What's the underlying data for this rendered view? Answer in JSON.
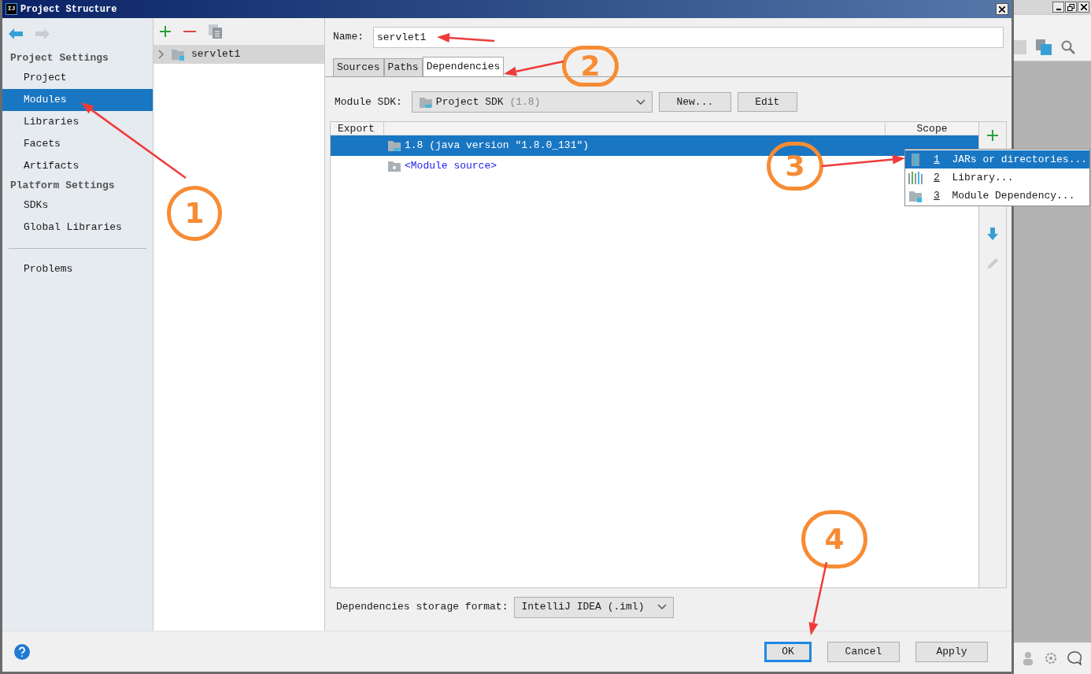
{
  "window": {
    "icon": "IJ",
    "title": "Project Structure"
  },
  "sidebar": {
    "sections": [
      {
        "heading": "Project Settings",
        "items": [
          {
            "label": "Project",
            "selected": false
          },
          {
            "label": "Modules",
            "selected": true
          },
          {
            "label": "Libraries",
            "selected": false
          },
          {
            "label": "Facets",
            "selected": false
          },
          {
            "label": "Artifacts",
            "selected": false
          }
        ]
      },
      {
        "heading": "Platform Settings",
        "items": [
          {
            "label": "SDKs",
            "selected": false
          },
          {
            "label": "Global Libraries",
            "selected": false
          }
        ]
      },
      {
        "items": [
          {
            "label": "Problems",
            "selected": false
          }
        ]
      }
    ]
  },
  "modules": {
    "items": [
      {
        "label": "servlet1",
        "selected": true
      }
    ]
  },
  "name_field": {
    "label": "Name:",
    "value": "servlet1"
  },
  "tabs": [
    {
      "label": "Sources",
      "selected": false
    },
    {
      "label": "Paths",
      "selected": false
    },
    {
      "label": "Dependencies",
      "selected": true
    }
  ],
  "module_sdk": {
    "label": "Module SDK:",
    "value": "Project SDK",
    "version": "(1.8)",
    "buttons": [
      "New...",
      "Edit"
    ]
  },
  "dependencies": {
    "columns": [
      "Export",
      "Scope"
    ],
    "rows": [
      {
        "label": "1.8 (java version \"1.8.0_131\")",
        "kind": "sdk",
        "selected": true
      },
      {
        "label": "<Module source>",
        "kind": "source",
        "selected": false
      }
    ]
  },
  "popup_menu": {
    "items": [
      {
        "number": "1",
        "label": "JARs or directories...",
        "kind": "jar",
        "selected": true
      },
      {
        "number": "2",
        "label": "Library...",
        "kind": "library",
        "selected": false
      },
      {
        "number": "3",
        "label": "Module Dependency...",
        "kind": "module",
        "selected": false
      }
    ]
  },
  "storage_format": {
    "label": "Dependencies storage format:",
    "value": "IntelliJ IDEA (.iml)"
  },
  "buttons": [
    {
      "label": "OK",
      "default": true
    },
    {
      "label": "Cancel",
      "default": false
    },
    {
      "label": "Apply",
      "default": false
    }
  ],
  "annotations": [
    {
      "label": "1"
    },
    {
      "label": "2"
    },
    {
      "label": "3"
    },
    {
      "label": "4"
    }
  ]
}
